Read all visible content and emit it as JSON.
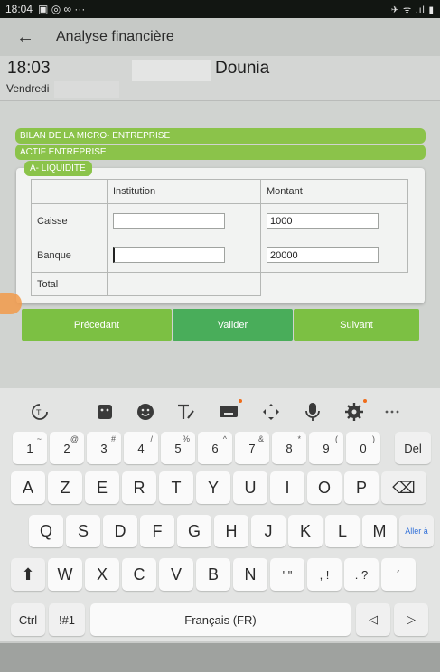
{
  "status_bar": {
    "time": "18:04",
    "icons_left": "▣ ◎ ∞ ···",
    "icons_right": "✈ ᯤ .ıl ▮"
  },
  "app_bar": {
    "back_icon": "←",
    "title": "Analyse financière"
  },
  "header": {
    "time": "18:03",
    "name": "Dounia",
    "day": "Vendredi"
  },
  "sections": {
    "bilan": "BILAN DE LA MICRO- ENTREPRISE",
    "actif": "ACTIF ENTREPRISE",
    "liquidite": "A- LIQUIDITE"
  },
  "table": {
    "headers": {
      "col1": "",
      "col2": "Institution",
      "col3": "Montant"
    },
    "rows": [
      {
        "label": "Caisse",
        "institution": "",
        "montant": "1000"
      },
      {
        "label": "Banque",
        "institution": "",
        "montant": "20000"
      }
    ],
    "total_label": "Total"
  },
  "buttons": {
    "prev": "Précedant",
    "valider": "Valider",
    "next": "Suivant"
  },
  "keyboard": {
    "toolbar_icons": [
      "translate-icon",
      "sticker-icon",
      "emoji-icon",
      "text-style-icon",
      "keyboard-icon",
      "move-cursor-icon",
      "mic-icon",
      "settings-icon",
      "more-icon"
    ],
    "row1": [
      {
        "k": "1",
        "s": "~"
      },
      {
        "k": "2",
        "s": "@"
      },
      {
        "k": "3",
        "s": "#"
      },
      {
        "k": "4",
        "s": "/"
      },
      {
        "k": "5",
        "s": "%"
      },
      {
        "k": "6",
        "s": "^"
      },
      {
        "k": "7",
        "s": "&"
      },
      {
        "k": "8",
        "s": "*"
      },
      {
        "k": "9",
        "s": "("
      },
      {
        "k": "0",
        "s": ")"
      },
      {
        "k": "Del",
        "s": ""
      }
    ],
    "row2": [
      "A",
      "Z",
      "E",
      "R",
      "T",
      "Y",
      "U",
      "I",
      "O",
      "P",
      "⌫"
    ],
    "row3": [
      "Q",
      "S",
      "D",
      "F",
      "G",
      "H",
      "J",
      "K",
      "L",
      "M",
      "Aller à"
    ],
    "row4": [
      "⬆",
      "W",
      "X",
      "C",
      "V",
      "B",
      "N",
      "' \"",
      ", !",
      ". ?",
      "´"
    ],
    "row5": {
      "ctrl": "Ctrl",
      "sym": "!#1",
      "space": "Français (FR)",
      "left": "◁",
      "right": "▷"
    }
  },
  "colors": {
    "accent_green": "#8bc34a",
    "valider_green": "#49ad5a",
    "notification_dot": "#ef6c1a"
  }
}
